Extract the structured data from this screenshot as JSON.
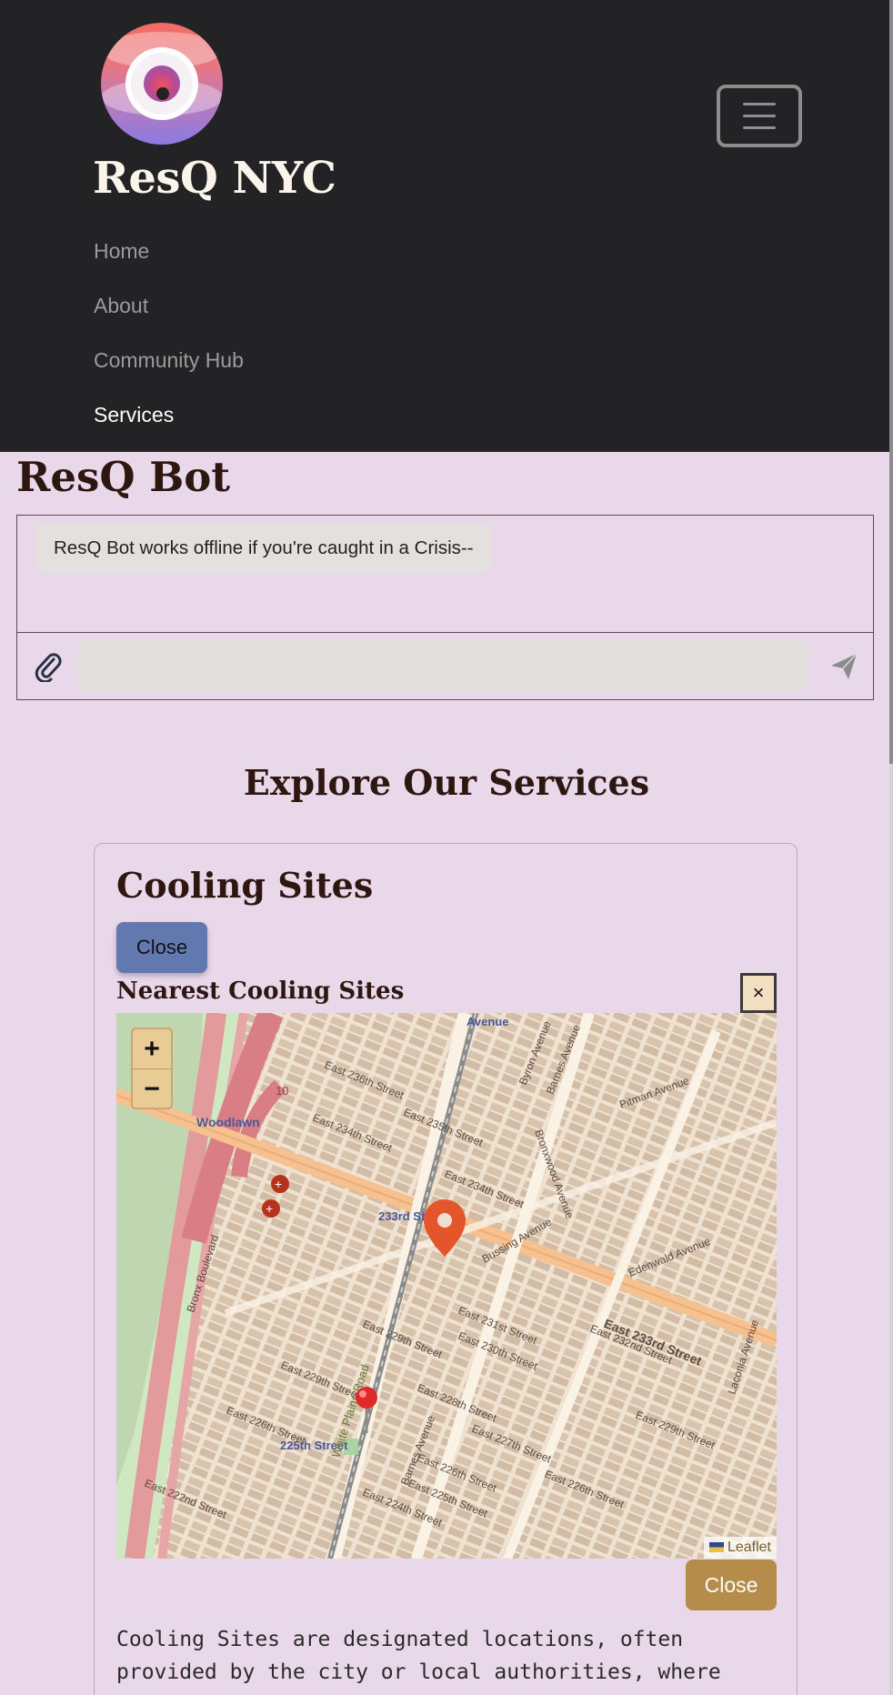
{
  "header": {
    "brand": "ResQ NYC",
    "logo_icon": "resq-lifebuoy-logo",
    "menu_icon": "hamburger-menu-icon",
    "nav": [
      {
        "label": "Home",
        "active": false
      },
      {
        "label": "About",
        "active": false
      },
      {
        "label": "Community Hub",
        "active": false
      },
      {
        "label": "Services",
        "active": true
      }
    ]
  },
  "bot": {
    "title": "ResQ Bot",
    "message": "ResQ Bot works offline if you're caught in a Crisis--",
    "input_value": "",
    "attach_icon": "paperclip-icon",
    "send_icon": "paper-plane-icon"
  },
  "services": {
    "title": "Explore Our Services",
    "card": {
      "title": "Cooling Sites",
      "close_label": "Close",
      "subtitle": "Nearest Cooling Sites",
      "dismiss_label": "×",
      "map": {
        "zoom_in": "+",
        "zoom_out": "−",
        "attribution": "Leaflet",
        "labels": {
          "woodlawn": "Woodlawn",
          "st233": "233rd Street",
          "st225": "225th Street",
          "e236": "East 236th Street",
          "e234": "East 234th Street",
          "e235": "East 235th Street",
          "e233": "East 233rd Street",
          "e231": "East 231st Street",
          "e230": "East 230th Street",
          "e229": "East 229th Street",
          "e228": "East 228th Street",
          "e227": "East 227th Street",
          "e226": "East 226th Street",
          "e225": "East 225th Street",
          "e224": "East 224th Street",
          "e222": "East 222nd Street",
          "e232": "East 232nd Street",
          "white_plains": "White Plains Road",
          "barnes": "Barnes Avenue",
          "bussing": "Bussing Avenue",
          "pitman": "Pitman Avenue",
          "edenwald": "Edenwald Avenue",
          "laconia": "Laconia Avenue",
          "bronxwood": "Bronxwood Avenue",
          "byron": "Byron Avenue",
          "bronx_blvd": "Bronx Boulevard",
          "avenue": "Avenue",
          "ten": "10"
        },
        "markers": [
          "current-location-marker",
          "cooling-site-pin"
        ],
        "colors": {
          "highway": "#f7c18f",
          "park": "#bfd6b1",
          "rail": "#7a7a7a",
          "marker": "#e5552c"
        }
      },
      "close_bottom_label": "Close",
      "description": "Cooling Sites are designated locations, often provided by the city or local authorities, where individuals can go to seek relief from extreme heat during heatwaves or"
    }
  },
  "colors": {
    "navbar_bg": "#232325",
    "page_bg": "#e9d8ea",
    "close_blue": "#6279b0",
    "close_gold": "#b58c4a"
  }
}
